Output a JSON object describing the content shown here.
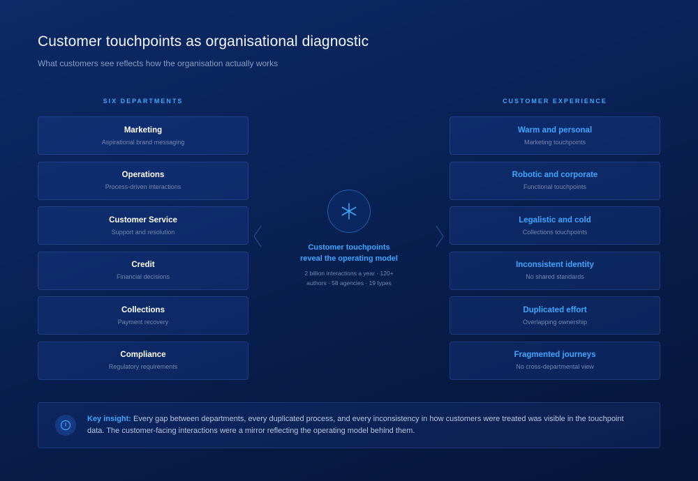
{
  "header": {
    "title": "Customer touchpoints as organisational diagnostic",
    "subtitle": "What customers see reflects how the organisation actually works"
  },
  "left_column": {
    "heading": "SIX DEPARTMENTS",
    "items": [
      {
        "title": "Marketing",
        "sub": "Aspirational brand messaging"
      },
      {
        "title": "Operations",
        "sub": "Process-driven interactions"
      },
      {
        "title": "Customer Service",
        "sub": "Support and resolution"
      },
      {
        "title": "Credit",
        "sub": "Financial decisions"
      },
      {
        "title": "Collections",
        "sub": "Payment recovery"
      },
      {
        "title": "Compliance",
        "sub": "Regulatory requirements"
      }
    ]
  },
  "right_column": {
    "heading": "CUSTOMER EXPERIENCE",
    "items": [
      {
        "title": "Warm and personal",
        "sub": "Marketing touchpoints"
      },
      {
        "title": "Robotic and corporate",
        "sub": "Functional touchpoints"
      },
      {
        "title": "Legalistic and cold",
        "sub": "Collections touchpoints"
      },
      {
        "title": "Inconsistent identity",
        "sub": "No shared standards"
      },
      {
        "title": "Duplicated effort",
        "sub": "Overlapping ownership"
      },
      {
        "title": "Fragmented journeys",
        "sub": "No cross-departmental view"
      }
    ]
  },
  "center": {
    "icon": "asterisk-icon",
    "title_line1": "Customer touchpoints",
    "title_line2": "reveal the operating model",
    "detail_line1": "2 billion interactions a year · 120+",
    "detail_line2": "authors · 58 agencies · 19 types"
  },
  "insight": {
    "icon": "info-circle-icon",
    "label": "Key insight:",
    "text": " Every gap between departments, every duplicated process, and every inconsistency in how customers were treated was visible in the touchpoint data. The customer-facing interactions were a mirror reflecting the operating model behind them."
  },
  "colors": {
    "accent": "#3ea6ff",
    "background": "#0a2358",
    "card_border": "#2c4a8a"
  }
}
